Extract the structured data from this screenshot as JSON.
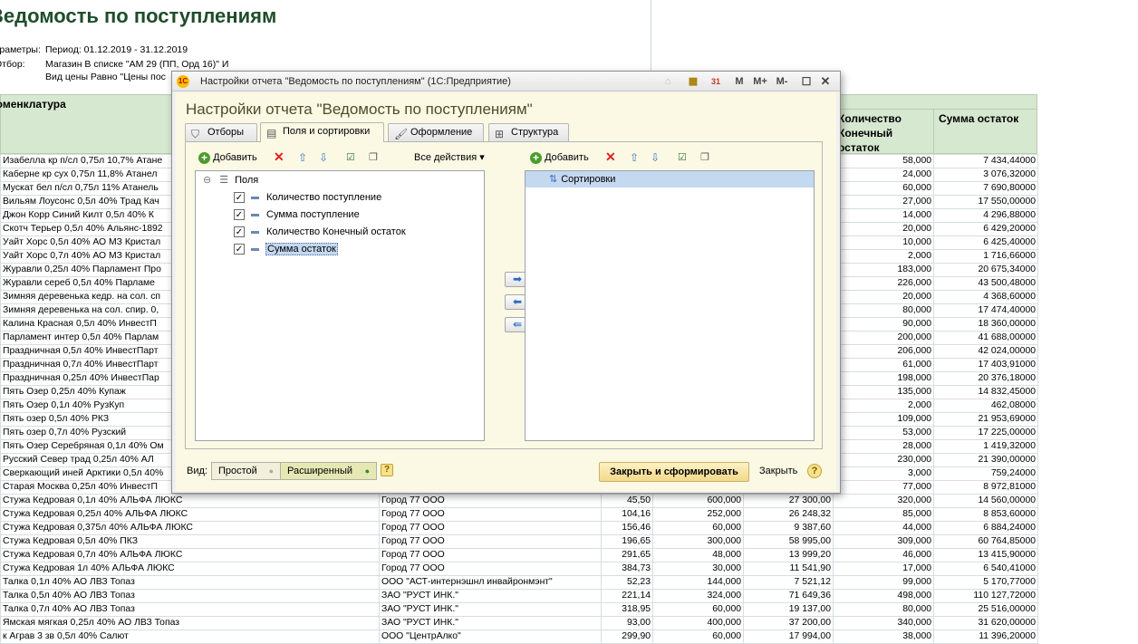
{
  "report": {
    "title": "Ведомость по поступлениям",
    "params": [
      {
        "label": "Параметры:",
        "value": "Период: 01.12.2019 - 31.12.2019"
      },
      {
        "label": "Отбор:",
        "value": "Магазин В списке \"АМ 29 (ПП, Орд 16)\" И"
      },
      {
        "label": "",
        "value": "Вид цены Равно \"Цены пос"
      }
    ],
    "headers": {
      "nomenclature": "Номенклатура",
      "qty_end": "Количество Конечный остаток",
      "sum_rest": "Сумма остаток"
    },
    "rows": [
      [
        "Изабелла кр п/сл 0,75л 10,7% Атане",
        "",
        "",
        "",
        "",
        "58,000",
        "7 434,44000"
      ],
      [
        "Каберне кр сух 0,75л 11,8% Атанел",
        "",
        "",
        "",
        "",
        "24,000",
        "3 076,32000"
      ],
      [
        "Мускат бел п/сл 0,75л 11% Атанель",
        "",
        "",
        "",
        "",
        "60,000",
        "7 690,80000"
      ],
      [
        "Вильям Лоусонс 0,5л 40% Трад Кач",
        "",
        "",
        "",
        "",
        "27,000",
        "17 550,00000"
      ],
      [
        "Джон Корр Синий Килт 0,5л 40% К",
        "",
        "",
        "",
        "",
        "14,000",
        "4 296,88000"
      ],
      [
        "Скотч Терьер 0,5л 40% Альянс-1892",
        "",
        "",
        "",
        "",
        "20,000",
        "6 429,20000"
      ],
      [
        "Уайт Хорс 0,5л 40% АО МЗ Кристал",
        "",
        "",
        "",
        "",
        "10,000",
        "6 425,40000"
      ],
      [
        "Уайт Хорс 0,7л 40% АО МЗ Кристал",
        "",
        "",
        "",
        "",
        "2,000",
        "1 716,66000"
      ],
      [
        "Журавли 0,25л 40% Парламент Про",
        "",
        "",
        "",
        "",
        "183,000",
        "20 675,34000"
      ],
      [
        "Журавли сереб 0,5л 40% Парламе",
        "",
        "",
        "",
        "",
        "226,000",
        "43 500,48000"
      ],
      [
        "Зимняя деревенька кедр. на сол. сп",
        "",
        "",
        "",
        "",
        "20,000",
        "4 368,60000"
      ],
      [
        "Зимняя деревенька на сол. спир. 0,",
        "",
        "",
        "",
        "",
        "80,000",
        "17 474,40000"
      ],
      [
        "Калина Красная 0,5л 40% ИнвестП",
        "",
        "",
        "",
        "",
        "90,000",
        "18 360,00000"
      ],
      [
        "Парламент интер 0,5л 40% Парлам",
        "",
        "",
        "",
        "",
        "200,000",
        "41 688,00000"
      ],
      [
        "Праздничная 0,5л 40% ИнвестПарт",
        "",
        "",
        "",
        "",
        "206,000",
        "42 024,00000"
      ],
      [
        "Праздничная 0,7л 40% ИнвестПарт",
        "",
        "",
        "",
        "",
        "61,000",
        "17 403,91000"
      ],
      [
        "Праздничная 0,25л 40% ИнвестПар",
        "",
        "",
        "",
        "",
        "198,000",
        "20 376,18000"
      ],
      [
        "Пять Озер 0,25л 40% Купаж",
        "",
        "",
        "",
        "",
        "135,000",
        "14 832,45000"
      ],
      [
        "Пять Озер 0,1л 40% РузКуп",
        "",
        "",
        "",
        "",
        "2,000",
        "462,08000"
      ],
      [
        "Пять озер 0,5л 40% РКЗ",
        "",
        "",
        "",
        "",
        "109,000",
        "21 953,69000"
      ],
      [
        "Пять озер 0,7л 40% Рузский",
        "",
        "",
        "",
        "",
        "53,000",
        "17 225,00000"
      ],
      [
        "Пять Озер Серебряная 0,1л 40% Ом",
        "",
        "",
        "",
        "",
        "28,000",
        "1 419,32000"
      ],
      [
        "Русский Север трад 0,25л 40% АЛ",
        "",
        "",
        "",
        "",
        "230,000",
        "21 390,00000"
      ],
      [
        "Сверкающий иней Арктики 0,5л 40%",
        "",
        "",
        "",
        "",
        "3,000",
        "759,24000"
      ],
      [
        "Старая Москва 0,25л 40% ИнвестП",
        "",
        "",
        "",
        "",
        "77,000",
        "8 972,81000"
      ],
      [
        "Стужа Кедровая 0,1л 40% АЛЬФА ЛЮКС",
        "Город 77 ООО",
        "45,50",
        "600,000",
        "27 300,00",
        "320,000",
        "14 560,00000"
      ],
      [
        "Стужа Кедровая 0,25л 40% АЛЬФА ЛЮКС",
        "Город 77 ООО",
        "104,16",
        "252,000",
        "26 248,32",
        "85,000",
        "8 853,60000"
      ],
      [
        "Стужа Кедровая 0,375л 40% АЛЬФА ЛЮКС",
        "Город 77 ООО",
        "156,46",
        "60,000",
        "9 387,60",
        "44,000",
        "6 884,24000"
      ],
      [
        "Стужа Кедровая 0,5л 40% ПКЗ",
        "Город 77 ООО",
        "196,65",
        "300,000",
        "58 995,00",
        "309,000",
        "60 764,85000"
      ],
      [
        "Стужа Кедровая 0,7л 40% АЛЬФА ЛЮКС",
        "Город 77 ООО",
        "291,65",
        "48,000",
        "13 999,20",
        "46,000",
        "13 415,90000"
      ],
      [
        "Стужа Кедровая 1л 40% АЛЬФА ЛЮКС",
        "Город 77 ООО",
        "384,73",
        "30,000",
        "11 541,90",
        "17,000",
        "6 540,41000"
      ],
      [
        "Талка 0,1л 40% АО ЛВЗ Топаз",
        "ООО \"АСТ-интернэшнл инвайронмэнт\"",
        "52,23",
        "144,000",
        "7 521,12",
        "99,000",
        "5 170,77000"
      ],
      [
        "Талка 0,5л 40% АО ЛВЗ Топаз",
        "ЗАО \"РУСТ ИНК.\"",
        "221,14",
        "324,000",
        "71 649,36",
        "498,000",
        "110 127,72000"
      ],
      [
        "Талка 0,7л 40% АО ЛВЗ Топаз",
        "ЗАО \"РУСТ ИНК.\"",
        "318,95",
        "60,000",
        "19 137,00",
        "80,000",
        "25 516,00000"
      ],
      [
        "Ямская мягкая 0,25л 40% АО ЛВЗ Топаз",
        "ЗАО \"РУСТ ИНК.\"",
        "93,00",
        "400,000",
        "37 200,00",
        "340,000",
        "31 620,00000"
      ],
      [
        "к Аграв 3 зв 0,5л 40% Салют",
        "ООО \"ЦентрАлко\"",
        "299,90",
        "60,000",
        "17 994,00",
        "38,000",
        "11 396,20000"
      ]
    ]
  },
  "dialog": {
    "window_title": "Настройки отчета \"Ведомость по поступлениям\" (1С:Предприятие)",
    "toolbar_icons": {
      "m": "M",
      "m_plus": "M+",
      "m_minus": "M-"
    },
    "heading": "Настройки отчета \"Ведомость по поступлениям\"",
    "tabs": [
      "Отборы",
      "Поля и сортировки",
      "Оформление",
      "Структура"
    ],
    "left": {
      "add": "Добавить",
      "all_actions": "Все действия",
      "root": "Поля",
      "fields": [
        "Количество поступление",
        "Сумма поступление",
        "Количество Конечный остаток",
        "Сумма остаток"
      ]
    },
    "right": {
      "add": "Добавить",
      "root": "Сортировки"
    },
    "view_label": "Вид:",
    "view_simple": "Простой",
    "view_advanced": "Расширенный",
    "close_generate": "Закрыть и сформировать",
    "close": "Закрыть",
    "help": "?"
  }
}
